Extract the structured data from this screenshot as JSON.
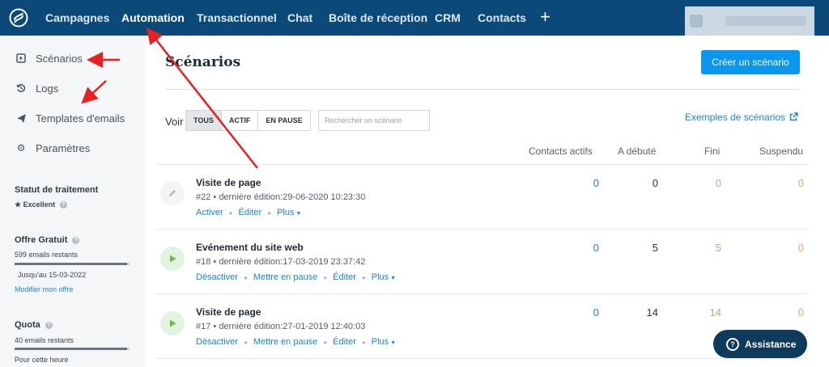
{
  "nav": {
    "items": [
      "Campagnes",
      "Automation",
      "Transactionnel",
      "Chat",
      "Boîte de réception",
      "CRM",
      "Contacts"
    ],
    "active": "Automation",
    "plus": "+"
  },
  "sidebar": {
    "items": [
      {
        "label": "Scénarios",
        "icon": "play-square-icon"
      },
      {
        "label": "Logs",
        "icon": "history-icon"
      },
      {
        "label": "Templates d'emails",
        "icon": "paper-plane-icon"
      },
      {
        "label": "Paramètres",
        "icon": "gear-icon"
      }
    ],
    "status": {
      "title": "Statut de traitement",
      "value": "Excellent"
    },
    "plan": {
      "title": "Offre Gratuit",
      "remaining": "599 emails restants",
      "until": "Jusqu'au 15-03-2022",
      "link": "Modifier mon offre",
      "usage": 0.98
    },
    "quota": {
      "title": "Quota",
      "remaining": "40 emails restants",
      "period": "Pour cette heure",
      "usage": 0.98
    }
  },
  "main": {
    "title": "Scénarios",
    "create_button": "Créer un scénario",
    "filter_label": "Voir",
    "filters": [
      "TOUS",
      "ACTIF",
      "EN PAUSE"
    ],
    "active_filter": "TOUS",
    "search_placeholder": "Rechercher un scénario",
    "examples_link": "Exemples de scénarios",
    "columns": [
      "Contacts actifs",
      "A débuté",
      "Fini",
      "Suspendu"
    ]
  },
  "scenarios": [
    {
      "title": "Visite de page",
      "meta": "#22 • dernière édition:29-06-2020 10:23:30",
      "icon": "pencil-icon",
      "actions": [
        "Activer",
        "Éditer",
        "Plus"
      ],
      "active": "0",
      "started": "0",
      "finished": "0",
      "suspended": "0"
    },
    {
      "title": "Evénement du site web",
      "meta": "#18 • dernière édition:17-03-2019 23:37:42",
      "icon": "play-icon",
      "actions": [
        "Désactiver",
        "Mettre en pause",
        "Éditer",
        "Plus"
      ],
      "active": "0",
      "started": "5",
      "finished": "5",
      "suspended": "0"
    },
    {
      "title": "Visite de page",
      "meta": "#17 • dernière édition:27-01-2019 12:40:03",
      "icon": "play-icon",
      "actions": [
        "Désactiver",
        "Mettre en pause",
        "Éditer",
        "Plus"
      ],
      "active": "0",
      "started": "14",
      "finished": "14",
      "suspended": "0"
    }
  ],
  "assistance": "Assistance",
  "colors": {
    "nav_bg": "#0b4a78",
    "primary": "#0b96f0",
    "link": "#1a85d6",
    "green": "#8dc26a",
    "orange": "#f0a35e",
    "annotation": "#e8201f"
  }
}
